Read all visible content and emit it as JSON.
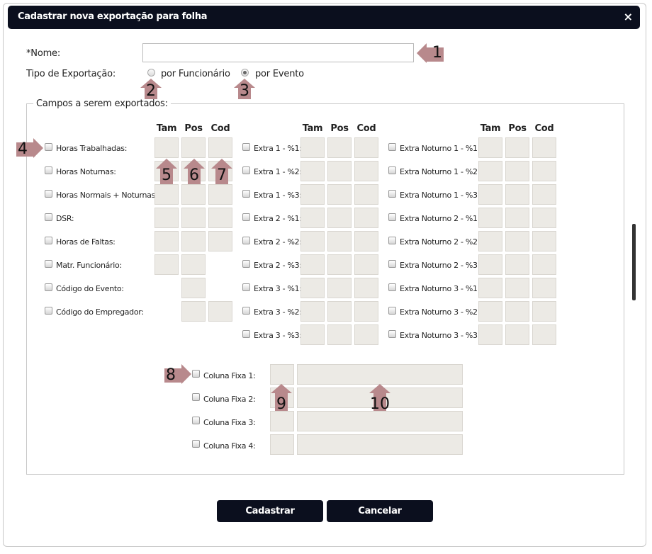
{
  "window": {
    "title": "Cadastrar nova exportação para folha",
    "close_symbol": "×"
  },
  "form": {
    "nome_label": "*Nome:",
    "nome_value": "",
    "tipo_label": "Tipo de Exportação:",
    "radio_funcionario": "por Funcionário",
    "radio_evento": "por Evento",
    "radio_selected": "por Evento"
  },
  "fields_legend": "Campos a serem exportados:",
  "col_headers": {
    "tam": "Tam",
    "pos": "Pos",
    "cod": "Cod"
  },
  "group1": [
    {
      "label": "Horas Trabalhadas:",
      "cols": [
        1,
        1,
        1
      ]
    },
    {
      "label": "Horas Noturnas:",
      "cols": [
        1,
        1,
        1
      ]
    },
    {
      "label": "Horas Normais + Noturnas:",
      "cols": [
        1,
        1,
        1
      ]
    },
    {
      "label": "DSR:",
      "cols": [
        1,
        1,
        1
      ]
    },
    {
      "label": "Horas de Faltas:",
      "cols": [
        1,
        1,
        1
      ]
    },
    {
      "label": "Matr. Funcionário:",
      "cols": [
        1,
        1,
        0
      ]
    },
    {
      "label": "Código do Evento:",
      "cols": [
        0,
        1,
        0
      ]
    },
    {
      "label": "Código do Empregador:",
      "cols": [
        0,
        1,
        1
      ]
    }
  ],
  "group2": [
    "Extra 1 - %1:",
    "Extra 1 - %2:",
    "Extra 1 - %3:",
    "Extra 2 - %1:",
    "Extra 2 - %2:",
    "Extra 2 - %3:",
    "Extra 3 - %1:",
    "Extra 3 - %2:",
    "Extra 3 - %3:"
  ],
  "group3": [
    "Extra Noturno 1 - %1:",
    "Extra Noturno 1 - %2:",
    "Extra Noturno 1 - %3:",
    "Extra Noturno 2 - %1:",
    "Extra Noturno 2 - %2:",
    "Extra Noturno 2 - %3:",
    "Extra Noturno 3 - %1:",
    "Extra Noturno 3 - %2:",
    "Extra Noturno 3 - %3:"
  ],
  "fixed_columns": [
    "Coluna Fixa 1:",
    "Coluna Fixa 2:",
    "Coluna Fixa 3:",
    "Coluna Fixa 4:"
  ],
  "buttons": {
    "submit": "Cadastrar",
    "cancel": "Cancelar"
  },
  "annotations": [
    "1",
    "2",
    "3",
    "4",
    "5",
    "6",
    "7",
    "8",
    "9",
    "10"
  ],
  "colors": {
    "titlebar": "#0b0f1e",
    "button": "#0b0f1e",
    "input_cell": "#eceae5",
    "arrow": "#b8898c"
  }
}
